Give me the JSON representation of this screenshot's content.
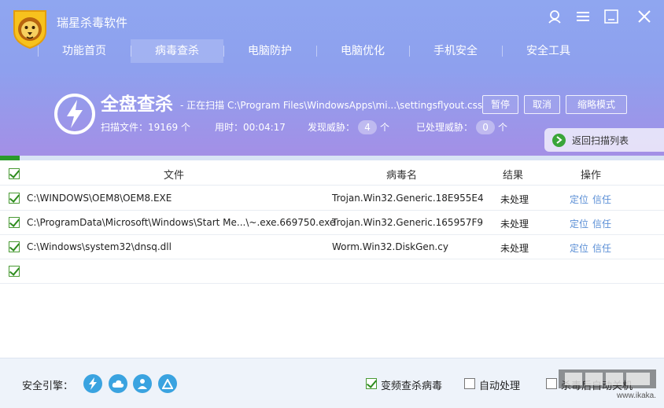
{
  "app": {
    "title": "瑞星杀毒软件"
  },
  "window_controls": [
    {
      "name": "user-icon"
    },
    {
      "name": "menu-icon"
    },
    {
      "name": "minimize-icon"
    },
    {
      "name": "close-icon"
    }
  ],
  "nav": {
    "tabs": [
      {
        "label": "功能首页",
        "active": false
      },
      {
        "label": "病毒查杀",
        "active": true
      },
      {
        "label": "电脑防护",
        "active": false
      },
      {
        "label": "电脑优化",
        "active": false
      },
      {
        "label": "手机安全",
        "active": false
      },
      {
        "label": "安全工具",
        "active": false
      }
    ]
  },
  "scan": {
    "title": "全盘查杀",
    "status": "- 正在扫描 C:\\Program Files\\WindowsApps\\mi...\\settingsflyout.css",
    "pause_label": "暂停",
    "cancel_label": "取消",
    "mini_label": "缩略模式",
    "files_label": "扫描文件：19169 个",
    "time_label": "用时：00:04:17",
    "threats_label": "发现威胁：",
    "threats_count": "4",
    "threats_unit": "个",
    "handled_label": "已处理威胁：",
    "handled_count": "0",
    "handled_unit": "个",
    "back_label": "返回扫描列表",
    "progress_fraction": 0.03
  },
  "table": {
    "headers": {
      "file": "文件",
      "virus": "病毒名",
      "result": "结果",
      "action": "操作"
    },
    "rows": [
      {
        "file": "C:\\WINDOWS\\OEM8\\OEM8.EXE",
        "virus": "Trojan.Win32.Generic.18E955E4",
        "result": "未处理",
        "locate": "定位",
        "trust": "信任"
      },
      {
        "file": "C:\\ProgramData\\Microsoft\\Windows\\Start Me...\\~.exe.669750.exe",
        "virus": "Trojan.Win32.Generic.165957F9",
        "result": "未处理",
        "locate": "定位",
        "trust": "信任"
      },
      {
        "file": "C:\\Windows\\system32\\dnsq.dll",
        "virus": "Worm.Win32.DiskGen.cy",
        "result": "未处理",
        "locate": "定位",
        "trust": "信任"
      }
    ]
  },
  "footer": {
    "engine_label": "安全引擎：",
    "engines": [
      "lightning-icon",
      "cloud-icon",
      "person-icon",
      "triangle-icon"
    ],
    "opt1": {
      "label": "变频查杀病毒",
      "checked": true
    },
    "opt2": {
      "label": "自动处理",
      "checked": false
    },
    "opt3": {
      "label": "杀毒后自动关机",
      "checked": false
    }
  },
  "watermark": {
    "text": "www.ikaka.com"
  },
  "colors": {
    "header_top": "#8fa6f0",
    "header_bottom": "#a48fe6",
    "progress": "#2a9a2a",
    "link": "#5b8fd6",
    "check": "#2e8c1e"
  }
}
